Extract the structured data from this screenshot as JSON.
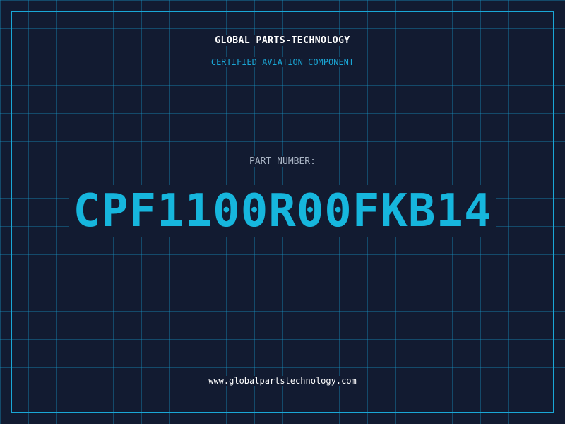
{
  "header": {
    "company": "GLOBAL PARTS-TECHNOLOGY",
    "tagline": "CERTIFIED AVIATION COMPONENT"
  },
  "part": {
    "label": "PART NUMBER:",
    "number": "CPF1100R00FKB14"
  },
  "footer": {
    "website": "www.globalpartstechnology.com"
  },
  "colors": {
    "background": "#121b31",
    "grid": "#1896c8",
    "accent": "#1aa7d6",
    "part_number": "#16b6dd",
    "title": "#ffffff",
    "label": "#a9b4c4"
  }
}
